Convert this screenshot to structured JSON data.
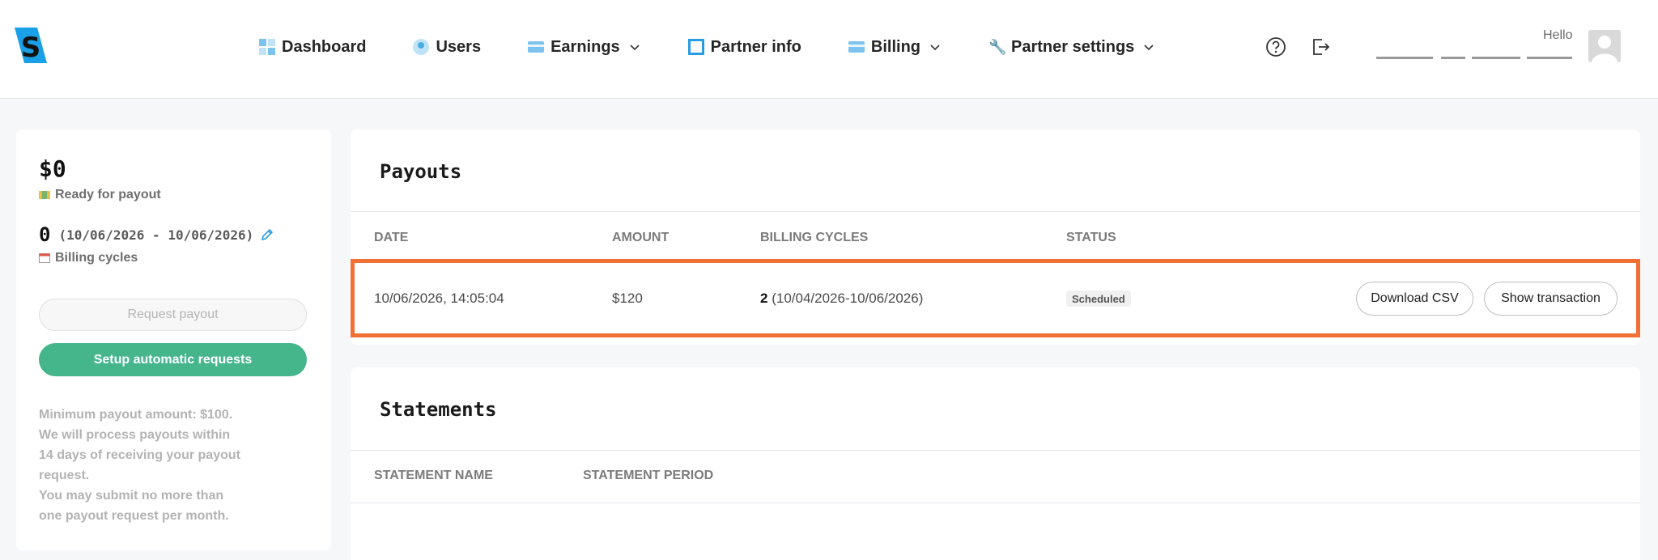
{
  "nav": {
    "items": [
      {
        "label": "Dashboard",
        "icon": "dashboard-icon",
        "dropdown": false
      },
      {
        "label": "Users",
        "icon": "user-icon",
        "dropdown": false
      },
      {
        "label": "Earnings",
        "icon": "card-icon",
        "dropdown": true
      },
      {
        "label": "Partner info",
        "icon": "square-icon",
        "dropdown": false
      },
      {
        "label": "Billing",
        "icon": "card-icon",
        "dropdown": true
      },
      {
        "label": "Partner settings",
        "icon": "wrench-icon",
        "dropdown": true
      }
    ]
  },
  "header": {
    "hello": "Hello"
  },
  "colors": {
    "accent": "#45b58c",
    "highlight": "#f07036",
    "brand": "#1aa0e6"
  },
  "summary": {
    "amount": "$0",
    "ready_label": "Ready for payout",
    "cycles_count": "0",
    "cycles_range": "(10/06/2026 - 10/06/2026)",
    "cycles_label": "Billing cycles",
    "request_button": "Request payout",
    "auto_button": "Setup automatic requests",
    "notes": [
      "Minimum payout amount: $100.",
      "We will process payouts within",
      "14 days of receiving your payout",
      "request.",
      "You may submit no more than",
      "one payout request per month."
    ]
  },
  "payouts": {
    "title": "Payouts",
    "columns": [
      "DATE",
      "AMOUNT",
      "BILLING CYCLES",
      "STATUS"
    ],
    "rows": [
      {
        "date": "10/06/2026, 14:05:04",
        "amount": "$120",
        "cycles_count": "2",
        "cycles_range": "(10/04/2026-10/06/2026)",
        "status": "Scheduled",
        "download_label": "Download CSV",
        "show_label": "Show transaction"
      }
    ]
  },
  "statements": {
    "title": "Statements",
    "columns": [
      "STATEMENT NAME",
      "STATEMENT PERIOD"
    ]
  }
}
